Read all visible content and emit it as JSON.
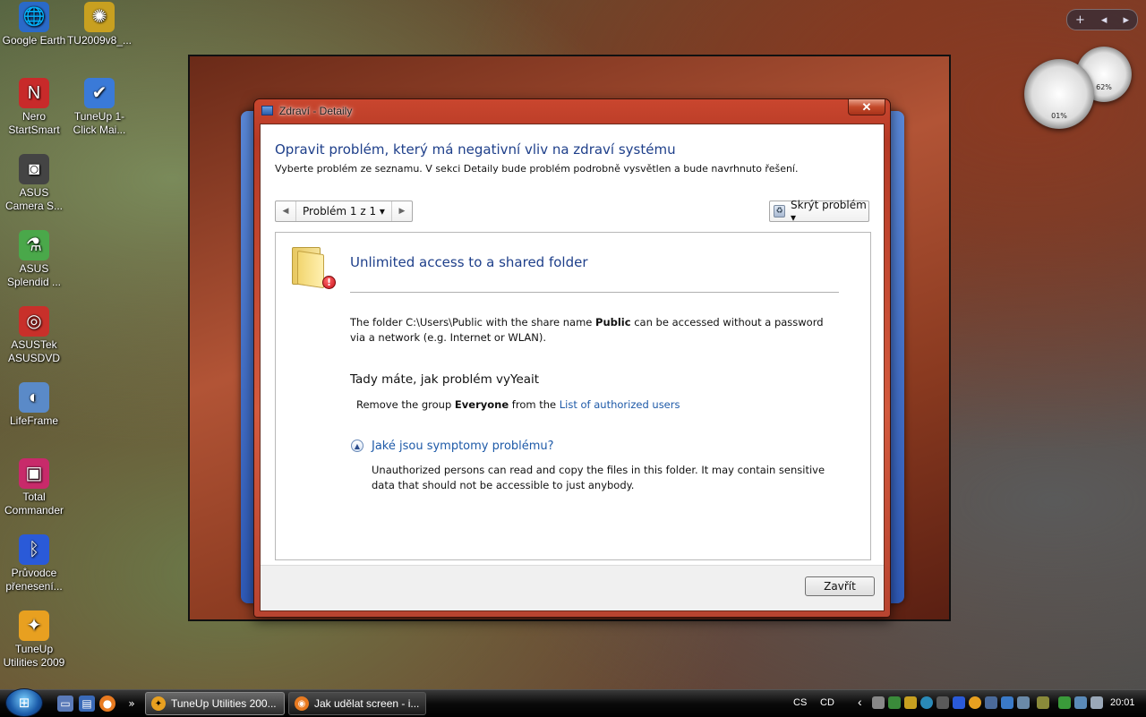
{
  "desktop_icons": [
    {
      "label": "Google Earth",
      "icon": "globe-icon",
      "color": "#2a6ac8"
    },
    {
      "label": "TU2009v8_...",
      "icon": "tuneup-icon",
      "color": "#c8a020"
    },
    {
      "label": "Nero StartSmart",
      "icon": "nero-icon",
      "color": "#c82a2a"
    },
    {
      "label": "TuneUp 1-Click Mai...",
      "icon": "tuneup-1click-icon",
      "color": "#3a7ad8"
    },
    {
      "label": "ASUS Camera S...",
      "icon": "camera-icon",
      "color": "#444444"
    },
    {
      "label": "ASUS Splendid ...",
      "icon": "splendid-icon",
      "color": "#4aa84a"
    },
    {
      "label": "ASUSTek ASUSDVD",
      "icon": "dvd-icon",
      "color": "#c8302a"
    },
    {
      "label": "LifeFrame",
      "icon": "lifeframe-icon",
      "color": "#5a8ac8"
    },
    {
      "label": "Total Commander",
      "icon": "floppy-icon",
      "color": "#c82a6a"
    },
    {
      "label": "Průvodce přenesení...",
      "icon": "bluetooth-icon",
      "color": "#2a5ad8"
    },
    {
      "label": "TuneUp Utilities 2009",
      "icon": "tuneup-utilities-icon",
      "color": "#e8a020"
    }
  ],
  "gadgets": {
    "cpu_label": "01%",
    "mem_label": "62%",
    "buttons": [
      "+",
      "◂",
      "▸"
    ]
  },
  "dialog": {
    "title": "Zdraví - Detaily",
    "close_glyph": "✕",
    "heading": "Opravit problém, který má negativní vliv na zdraví systému",
    "subheading": "Vyberte problém ze seznamu. V sekci Detaily bude problém podrobně vysvětlen a bude navrhnuto řešení.",
    "nav": {
      "prev": "◀",
      "label": "Problém 1 z 1 ▾",
      "next": "▶"
    },
    "hide_label": "Skrýt problém ▾",
    "problem": {
      "title": "Unlimited access to a shared folder",
      "desc_pre": "The folder C:\\Users\\Public with the share name ",
      "desc_bold": "Public",
      "desc_post": " can be accessed without a password via a network (e.g. Internet or WLAN).",
      "fix_heading": "Tady máte, jak problém vyYeait",
      "fix_pre": "Remove the group ",
      "fix_bold": "Everyone",
      "fix_mid": " from the ",
      "fix_link": "List of authorized users",
      "symptoms_heading": "Jaké jsou symptomy problému?",
      "symptoms_text": "Unauthorized persons can read and copy the files in this folder. It may contain sensitive data that should not be accessible to just anybody."
    },
    "close_button": "Zavřít"
  },
  "taskbar": {
    "start_glyph": "⊞",
    "quicklaunch_more": "»",
    "buttons": [
      {
        "label": "TuneUp Utilities 200...",
        "icon": "tuneup-icon"
      },
      {
        "label": "Jak udělat screen - i...",
        "icon": "firefox-icon"
      }
    ],
    "lang": "CS",
    "cd": "CD",
    "tray_arrow": "‹",
    "clock": "20:01"
  },
  "colors": {
    "heading_blue": "#1e3f8a",
    "link_blue": "#1e5aa8",
    "frame_red": "#c9462e"
  }
}
